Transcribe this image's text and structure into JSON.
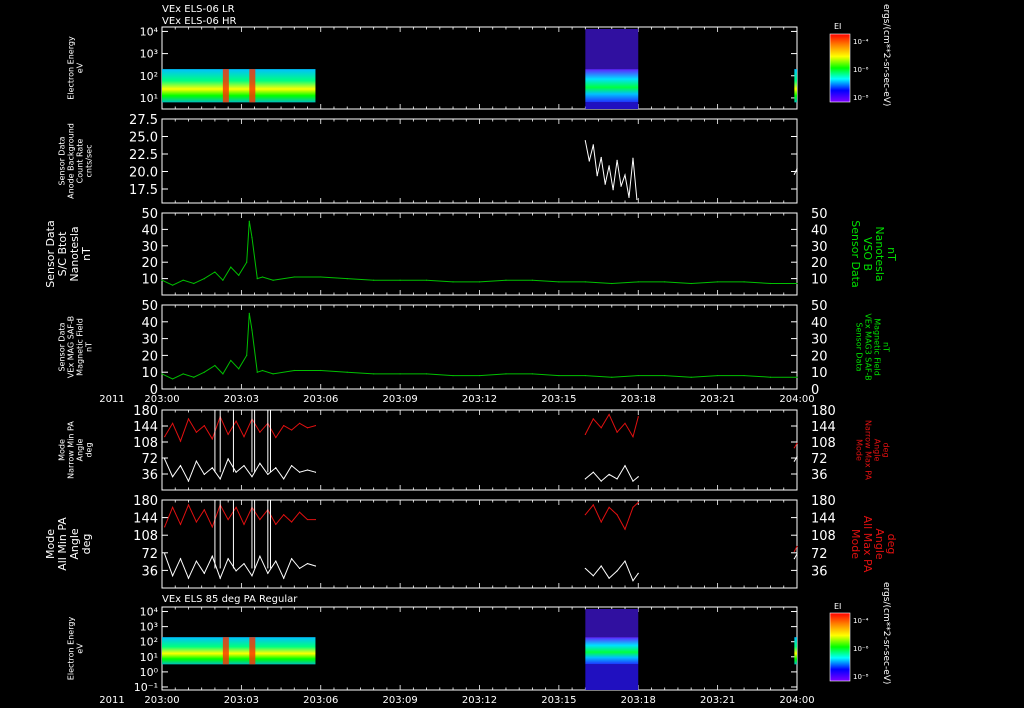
{
  "titles": {
    "top_line1": "VEx ELS-06 LR",
    "top_line2": "VEx ELS-06 HR",
    "bottom": "VEx ELS 85 deg PA Regular"
  },
  "colorbar": {
    "label": "EI",
    "unit": "ergs/(cm**2-sr-sec-eV)",
    "ticks": [
      "10⁻⁴",
      "10⁻⁶",
      "10⁻⁸"
    ],
    "colors": [
      "#ff0000",
      "#ff8000",
      "#ffff00",
      "#00ff00",
      "#00ffff",
      "#0000ff",
      "#8000ff"
    ]
  },
  "x_axis": {
    "year": "2011",
    "ticks": [
      "203:00",
      "203:03",
      "203:06",
      "203:09",
      "203:12",
      "203:15",
      "203:18",
      "203:21",
      "204:00"
    ]
  },
  "chart_data": [
    {
      "type": "heatmap",
      "ylabel_lines": [
        "Electron Energy",
        "eV"
      ],
      "ytick_labels": [
        "10⁴",
        "10³",
        "10²",
        "10¹"
      ],
      "ylim_log10": [
        0.5,
        4.2
      ],
      "data_blocks_x": [
        [
          0.0,
          5.8
        ],
        [
          16.0,
          18.0
        ],
        [
          23.9,
          24.0
        ]
      ]
    },
    {
      "type": "line",
      "ylabel_lines": [
        "Sensor Data",
        "Anode Background",
        "Count Rate",
        "cnts/sec"
      ],
      "yticks": [
        "27.5",
        "25.0",
        "22.5",
        "20.0",
        "17.5"
      ],
      "ylim": [
        15.5,
        27.5
      ],
      "series": [
        {
          "color": "#ffffff",
          "x": [
            16.0,
            16.15,
            16.3,
            16.45,
            16.6,
            16.75,
            16.9,
            17.05,
            17.2,
            17.35,
            17.5,
            17.65,
            17.8,
            17.95,
            23.9,
            24.0
          ],
          "y": [
            24.4,
            21.5,
            23.8,
            19.4,
            22.0,
            18.2,
            20.8,
            17.4,
            21.6,
            17.9,
            19.5,
            16.3,
            21.9,
            16.0,
            19.6,
            20.4
          ]
        }
      ]
    },
    {
      "type": "line",
      "ylabel_lines": [
        "Sensor Data",
        "S/C Btot",
        "Nanotesla",
        "nT"
      ],
      "right_label_lines": [
        "Sensor Data",
        "VSO B",
        "Nanotesla",
        "nT"
      ],
      "yticks": [
        "50",
        "40",
        "30",
        "20",
        "10"
      ],
      "ylim": [
        0,
        50
      ],
      "series": [
        {
          "color": "#00c000",
          "x": [
            0,
            0.4,
            0.8,
            1.2,
            1.6,
            2.0,
            2.3,
            2.6,
            2.9,
            3.2,
            3.3,
            3.4,
            3.6,
            3.8,
            4.2,
            5.0,
            6.0,
            7.0,
            8.0,
            9.0,
            10.0,
            11.0,
            12.0,
            13.0,
            14.0,
            15.0,
            16.0,
            17.0,
            18.0,
            19.0,
            20.0,
            21.0,
            22.0,
            23.0,
            24.0
          ],
          "y": [
            9,
            6,
            9,
            7,
            10,
            14,
            9,
            17,
            12,
            20,
            45,
            35,
            10,
            11,
            9,
            11,
            11,
            10,
            9,
            9,
            9,
            8,
            8,
            9,
            9,
            8,
            8,
            7,
            8,
            8,
            7,
            8,
            8,
            7,
            7
          ]
        }
      ]
    },
    {
      "type": "line",
      "ylabel_lines": [
        "Sensor Data",
        "VEx MAG SAF-B",
        "Magnetic Field",
        "nT"
      ],
      "right_label_lines": [
        "Sensor Data",
        "VEx MAG3 SAF-B",
        "Magnetic Field",
        "nT"
      ],
      "yticks": [
        "50",
        "40",
        "30",
        "20",
        "10",
        "0"
      ],
      "ylim": [
        0,
        50
      ],
      "series": [
        {
          "color": "#00c000",
          "x": [
            0,
            0.4,
            0.8,
            1.2,
            1.6,
            2.0,
            2.3,
            2.6,
            2.9,
            3.2,
            3.3,
            3.4,
            3.6,
            3.8,
            4.2,
            5.0,
            6.0,
            7.0,
            8.0,
            9.0,
            10.0,
            11.0,
            12.0,
            13.0,
            14.0,
            15.0,
            16.0,
            17.0,
            18.0,
            19.0,
            20.0,
            21.0,
            22.0,
            23.0,
            24.0
          ],
          "y": [
            9,
            6,
            9,
            7,
            10,
            14,
            9,
            17,
            12,
            20,
            45,
            35,
            10,
            11,
            9,
            11,
            11,
            10,
            9,
            9,
            9,
            8,
            8,
            9,
            9,
            8,
            8,
            7,
            8,
            8,
            7,
            8,
            8,
            7,
            7
          ]
        }
      ]
    },
    {
      "type": "line",
      "ylabel_lines": [
        "Mode",
        "Narrow Min PA",
        "Angle",
        "deg"
      ],
      "right_label_lines": [
        "Mode",
        "Narrow Max PA",
        "Angle",
        "deg"
      ],
      "yticks": [
        "180",
        "144",
        "108",
        "72",
        "36"
      ],
      "ylim": [
        0,
        180
      ],
      "series": [
        {
          "name": "Max PA",
          "color": "#e01010",
          "x": [
            0.1,
            0.4,
            0.7,
            1.0,
            1.3,
            1.6,
            1.9,
            2.2,
            2.5,
            2.8,
            3.1,
            3.4,
            3.7,
            4.0,
            4.3,
            4.6,
            4.9,
            5.2,
            5.5,
            5.8,
            16.0,
            16.3,
            16.6,
            16.9,
            17.2,
            17.5,
            17.8,
            18.0,
            23.9,
            24.0
          ],
          "y": [
            120,
            150,
            110,
            160,
            130,
            145,
            115,
            165,
            125,
            155,
            120,
            160,
            130,
            150,
            118,
            145,
            135,
            150,
            140,
            145,
            125,
            160,
            140,
            170,
            130,
            150,
            120,
            165,
            95,
            105
          ]
        },
        {
          "name": "Min PA",
          "color": "#ffffff",
          "x": [
            0.1,
            0.4,
            0.7,
            1.0,
            1.3,
            1.6,
            1.9,
            2.2,
            2.5,
            2.8,
            3.1,
            3.4,
            3.7,
            4.0,
            4.3,
            4.6,
            4.9,
            5.2,
            5.5,
            5.8,
            16.0,
            16.3,
            16.6,
            16.9,
            17.2,
            17.5,
            17.8,
            18.0,
            23.9,
            24.0
          ],
          "y": [
            70,
            30,
            55,
            20,
            65,
            35,
            50,
            25,
            70,
            40,
            55,
            30,
            60,
            35,
            50,
            25,
            55,
            40,
            45,
            40,
            25,
            40,
            20,
            35,
            25,
            55,
            20,
            30,
            65,
            75
          ]
        }
      ]
    },
    {
      "type": "line",
      "ylabel_lines": [
        "Mode",
        "All Min PA",
        "Angle",
        "deg"
      ],
      "right_label_lines": [
        "Mode",
        "All Max PA",
        "Angle",
        "deg"
      ],
      "yticks": [
        "180",
        "144",
        "108",
        "72",
        "36"
      ],
      "ylim": [
        0,
        180
      ],
      "series": [
        {
          "name": "Max PA",
          "color": "#e01010",
          "x": [
            0.1,
            0.4,
            0.7,
            1.0,
            1.3,
            1.6,
            1.9,
            2.2,
            2.5,
            2.8,
            3.1,
            3.4,
            3.7,
            4.0,
            4.3,
            4.6,
            4.9,
            5.2,
            5.5,
            5.8,
            16.0,
            16.3,
            16.6,
            16.9,
            17.2,
            17.5,
            17.8,
            18.0,
            23.9,
            24.0
          ],
          "y": [
            125,
            165,
            130,
            170,
            135,
            160,
            125,
            170,
            140,
            165,
            130,
            165,
            140,
            160,
            130,
            150,
            135,
            155,
            140,
            140,
            150,
            170,
            135,
            165,
            150,
            120,
            165,
            175,
            75,
            85
          ]
        },
        {
          "name": "Min PA",
          "color": "#ffffff",
          "x": [
            0.1,
            0.4,
            0.7,
            1.0,
            1.3,
            1.6,
            1.9,
            2.2,
            2.5,
            2.8,
            3.1,
            3.4,
            3.7,
            4.0,
            4.3,
            4.6,
            4.9,
            5.2,
            5.5,
            5.8,
            16.0,
            16.3,
            16.6,
            16.9,
            17.2,
            17.5,
            17.8,
            18.0,
            23.9,
            24.0
          ],
          "y": [
            70,
            25,
            60,
            20,
            55,
            30,
            65,
            20,
            60,
            35,
            50,
            25,
            65,
            30,
            55,
            20,
            60,
            40,
            50,
            45,
            40,
            25,
            45,
            20,
            35,
            55,
            15,
            30,
            60,
            70
          ]
        }
      ]
    },
    {
      "type": "heatmap",
      "ylabel_lines": [
        "Electron Energy",
        "eV"
      ],
      "ytick_labels": [
        "10⁴",
        "10³",
        "10²",
        "10¹",
        "10⁰",
        "10⁻¹"
      ],
      "ylim_log10": [
        -1.2,
        4.3
      ],
      "data_blocks_x": [
        [
          0.0,
          5.8
        ],
        [
          16.0,
          18.0
        ],
        [
          23.9,
          24.0
        ]
      ]
    }
  ]
}
